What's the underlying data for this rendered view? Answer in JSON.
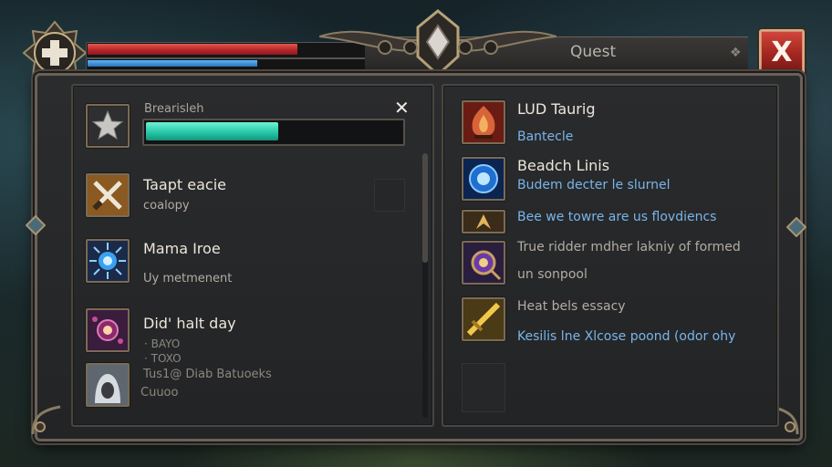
{
  "window": {
    "title": "Quest",
    "close_label": "X",
    "dismiss_label": "✕",
    "title_deco": "❖"
  },
  "hud": {
    "health_fraction": 0.72,
    "mana_fraction": 0.58
  },
  "left_panel": {
    "progress": {
      "label": "Brearisleh",
      "fraction": 0.52
    },
    "items": [
      {
        "title": "Taapt eacie",
        "subtitle": "coalopy"
      },
      {
        "title": "Mama Iroe",
        "subtitle": "Uy metmenent"
      },
      {
        "title": "Did' halt day",
        "details": [
          "· BAYO",
          "· TOXO"
        ]
      },
      {
        "title": "Tus1@ Diab Batuoeks",
        "subtitle": "Cuuoo"
      }
    ]
  },
  "right_panel": {
    "entries": [
      {
        "title": "LUD Taurig",
        "text": "Bantecle"
      },
      {
        "title": "Beadch Linis",
        "text": "Budem decter le slurnel"
      },
      {
        "text": "Bee we towre are us flovdiencs"
      },
      {
        "text": "True ridder mdher lakniy of formed",
        "text2": "un sonpool"
      },
      {
        "text": "Heat bels essacy",
        "text2": "Kesilis lne Xlcose poond (odor ohy"
      }
    ]
  },
  "colors": {
    "health": "#c02a2c",
    "mana": "#2f84d2",
    "progress": "#2ccfae",
    "close": "#b32b23",
    "frame_trim": "#6b6157"
  }
}
